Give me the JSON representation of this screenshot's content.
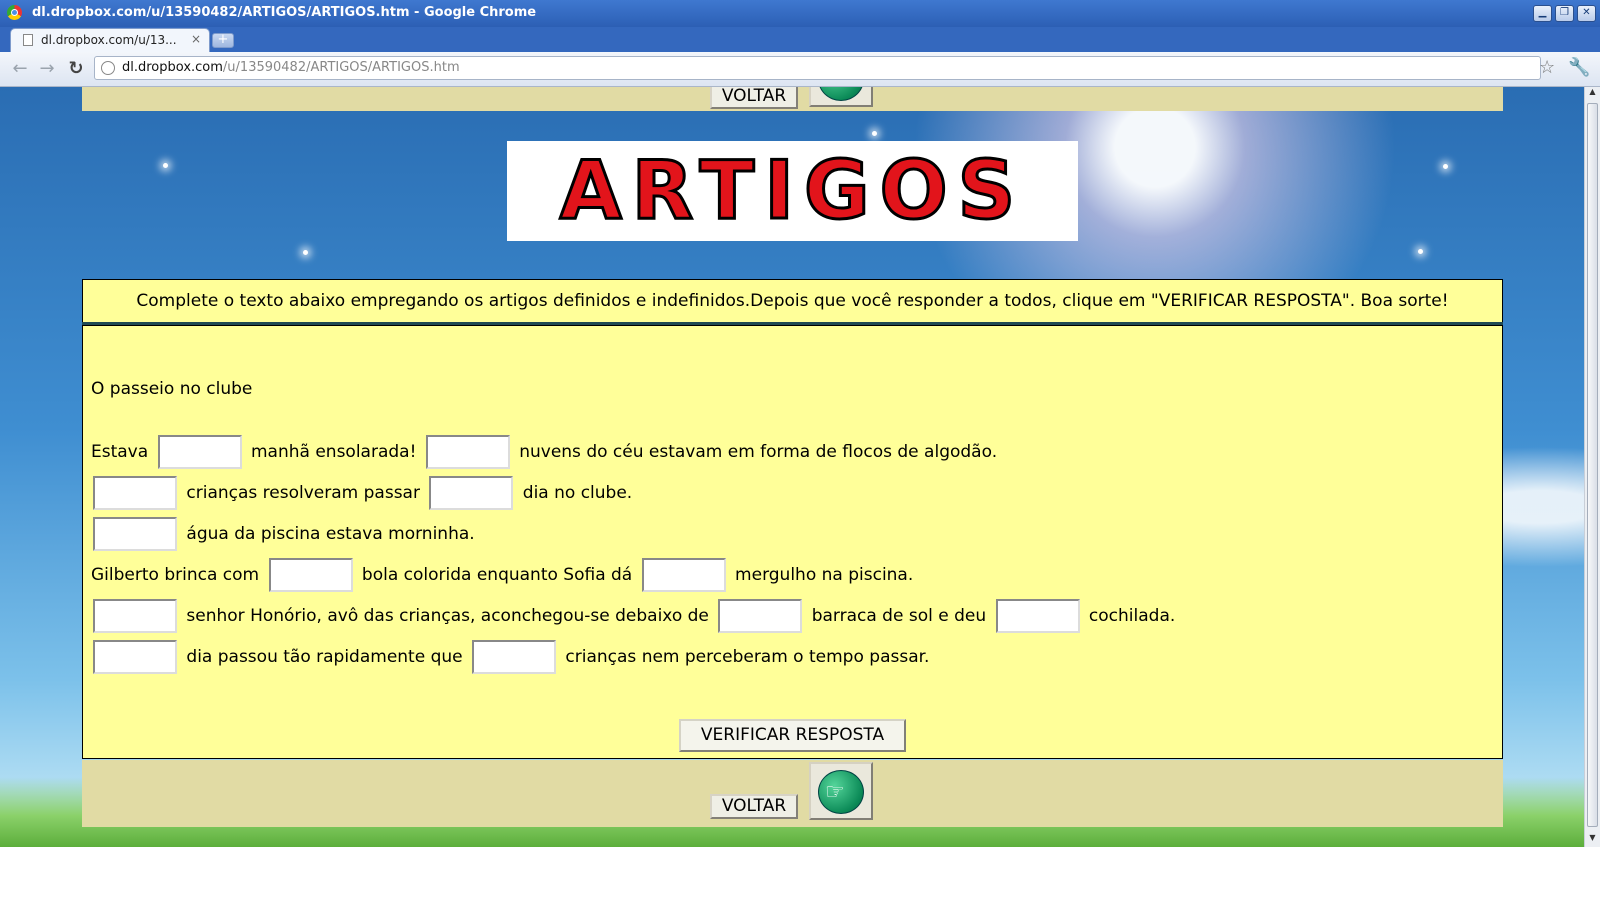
{
  "window": {
    "title": "dl.dropbox.com/u/13590482/ARTIGOS/ARTIGOS.htm - Google Chrome",
    "min": "▁",
    "max": "❐",
    "close": "✕"
  },
  "tab": {
    "title": "dl.dropbox.com/u/13...",
    "close": "×",
    "newtab": "+"
  },
  "toolbar": {
    "back": "←",
    "forward": "→",
    "reload": "↻",
    "url_host": "dl.dropbox.com",
    "url_path": "/u/13590482/ARTIGOS/ARTIGOS.htm",
    "star": "☆",
    "wrench": "🔧"
  },
  "nav": {
    "voltar_label": "VOLTAR",
    "hand": "☞"
  },
  "logo": {
    "text": "ARTIGOS"
  },
  "instructions": "Complete o texto abaixo empregando os artigos definidos e indefinidos.Depois que você responder a todos, clique em \"VERIFICAR RESPOSTA\". Boa sorte!",
  "story": {
    "title": "O passeio no clube",
    "line1": {
      "a": "Estava",
      "b": "manhã ensolarada!",
      "c": "nuvens do céu estavam em forma de flocos de algodão."
    },
    "line2": {
      "a": "crianças resolveram passar",
      "b": "dia no clube."
    },
    "line3": {
      "a": "água da piscina estava morninha."
    },
    "line4": {
      "a": "Gilberto brinca com",
      "b": "bola colorida enquanto Sofia dá",
      "c": "mergulho na piscina."
    },
    "line5": {
      "a": "senhor Honório, avô das crianças, aconchegou-se debaixo de",
      "b": "barraca de sol e deu",
      "c": "cochilada."
    },
    "line6": {
      "a": "dia passou tão rapidamente que",
      "b": "crianças nem perceberam o tempo passar."
    }
  },
  "verify_label": "VERIFICAR RESPOSTA",
  "scroll": {
    "up": "▲",
    "down": "▼"
  }
}
